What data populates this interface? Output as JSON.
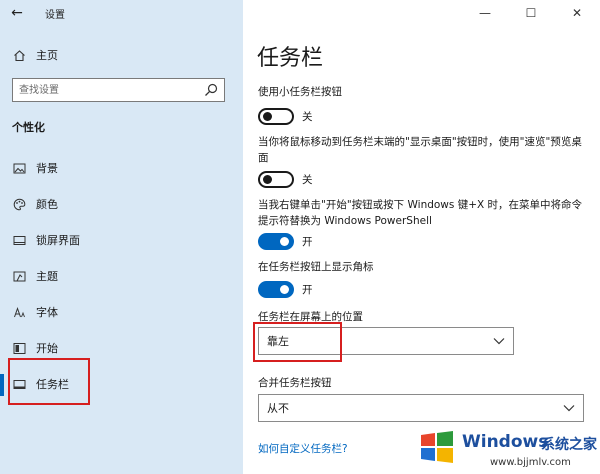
{
  "window": {
    "title": "设置",
    "minimize": "—",
    "maximize": "☐",
    "close": "✕"
  },
  "sidebar": {
    "back_glyph": "←",
    "home_label": "主页",
    "search": {
      "placeholder": "查找设置"
    },
    "section": "个性化",
    "items": [
      {
        "label": "背景",
        "icon": "picture-icon"
      },
      {
        "label": "颜色",
        "icon": "palette-icon"
      },
      {
        "label": "锁屏界面",
        "icon": "lock-screen-icon"
      },
      {
        "label": "主题",
        "icon": "theme-icon"
      },
      {
        "label": "字体",
        "icon": "font-icon"
      },
      {
        "label": "开始",
        "icon": "start-icon"
      },
      {
        "label": "任务栏",
        "icon": "taskbar-icon",
        "selected": true
      }
    ]
  },
  "main": {
    "title": "任务栏",
    "settings": [
      {
        "label": "使用小任务栏按钮",
        "state": "关",
        "on": false
      },
      {
        "label": "当你将鼠标移动到任务栏末端的\"显示桌面\"按钮时，使用\"速览\"预览桌面",
        "state": "关",
        "on": false
      },
      {
        "label": "当我右键单击\"开始\"按钮或按下 Windows 键+X 时，在菜单中将命令提示符替换为 Windows PowerShell",
        "state": "开",
        "on": true
      },
      {
        "label": "在任务栏按钮上显示角标",
        "state": "开",
        "on": true
      }
    ],
    "position": {
      "label": "任务栏在屏幕上的位置",
      "value": "靠左"
    },
    "combine": {
      "label": "合并任务栏按钮",
      "value": "从不"
    },
    "link": "如何自定义任务栏?"
  },
  "watermark": {
    "brand": "Windows",
    "brand_cn": "系统之家",
    "url": "www.bjjmlv.com"
  },
  "colors": {
    "accent": "#0067c0",
    "sidebar_bg": "#d9e8f5",
    "highlight": "#d61f1f"
  }
}
